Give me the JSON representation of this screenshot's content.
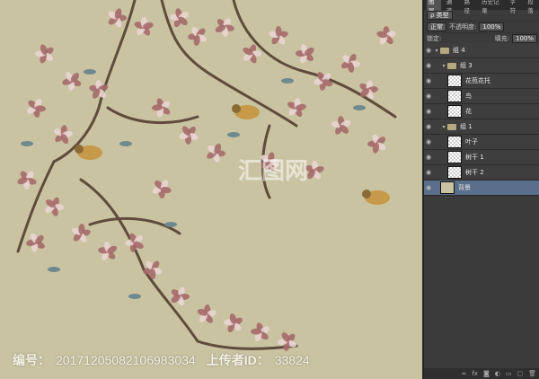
{
  "footer": {
    "id_label": "编号：",
    "id_value": "20171205082106983034",
    "uploader_label": "上传者ID：",
    "uploader_value": "33824"
  },
  "panel": {
    "tabs": [
      "图层",
      "通道",
      "路径",
      "历史记录",
      "字符",
      "段落"
    ],
    "kind_select": "ρ 类型",
    "blend_select": "正常",
    "opacity_label": "不透明度:",
    "opacity_value": "100%",
    "lock_label": "锁定:",
    "fill_label": "填充:",
    "fill_value": "100%",
    "layers": [
      {
        "name": "组 4",
        "type": "group",
        "indent": 0
      },
      {
        "name": "组 3",
        "type": "group",
        "indent": 1
      },
      {
        "name": "花苞花托",
        "type": "layer",
        "indent": 2
      },
      {
        "name": "鸟",
        "type": "layer",
        "indent": 2
      },
      {
        "name": "花",
        "type": "layer",
        "indent": 2
      },
      {
        "name": "组 1",
        "type": "group",
        "indent": 1
      },
      {
        "name": "叶子",
        "type": "layer",
        "indent": 2
      },
      {
        "name": "树干 1",
        "type": "layer",
        "indent": 2
      },
      {
        "name": "树干 2",
        "type": "layer",
        "indent": 2
      },
      {
        "name": "背景",
        "type": "background",
        "indent": 1
      }
    ]
  },
  "colors": {
    "canvas_bg": "#c9c3a2",
    "panel_bg": "#3b3b3b",
    "selected_layer": "#5a6f8a",
    "flower": "#e9d5d2",
    "flower_dark": "#a56b6a",
    "branch": "#5f4b3b",
    "leaf": "#6f8a8f"
  }
}
